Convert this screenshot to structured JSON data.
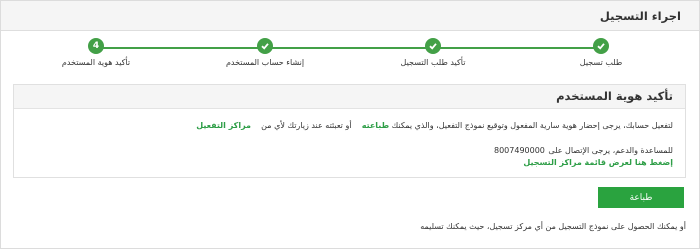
{
  "header": {
    "title": "اجراء التسجيل"
  },
  "steps": [
    {
      "label": "طلب تسجيل",
      "state": "done",
      "icon": "check-icon"
    },
    {
      "label": "تأكيد طلب التسجيل",
      "state": "done",
      "icon": "check-icon"
    },
    {
      "label": "إنشاء حساب المستخدم",
      "state": "done",
      "icon": "check-icon"
    },
    {
      "label": "تأكيد هوية المستخدم",
      "state": "current",
      "number": "4"
    }
  ],
  "panel": {
    "title": "تأكيد هوية المستخدم",
    "line1_text": "لتفعيل حسابك، يرجى إحضار هوية سارية المفعول وتوقيع نموذج التفعيل، والذي يمكنك",
    "line1_link": "طباعته",
    "line1_text2": "أو تعبئته عند زيارتك لأي من",
    "line1_link2": "مراكز التفعيل",
    "help_text": "للمساعدة والدعم، يرجى الإتصال على",
    "phone": "8007490000",
    "centers_link": "إضغط هنا لعرض قائمة مراكز التسجيل"
  },
  "print_button": "طباعة",
  "footer_note": "أو يمكنك الحصول على نموذج التسجيل من أي مركز تسجيل، حيث يمكنك تسليمه",
  "colors": {
    "accent": "#2aa33f",
    "step": "#43a047"
  }
}
